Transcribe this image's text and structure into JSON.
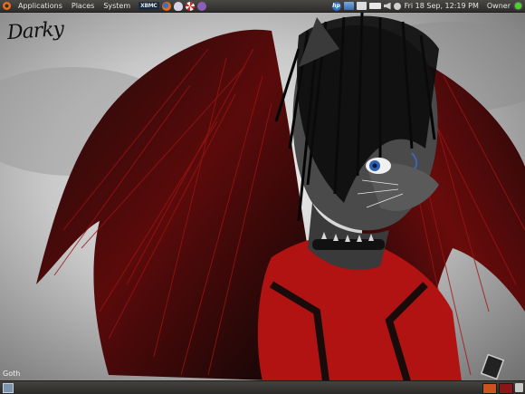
{
  "top_panel": {
    "menus": [
      "Applications",
      "Places",
      "System"
    ],
    "launchers": [
      {
        "name": "xbmc",
        "label": "XBMC"
      },
      {
        "name": "firefox-icon"
      },
      {
        "name": "pidgin-icon"
      },
      {
        "name": "help-lifebuoy-icon"
      },
      {
        "name": "game-icon"
      }
    ],
    "tray": {
      "icons": [
        "hp-icon",
        "network-icon",
        "mail-icon",
        "battery-icon",
        "volume-icon",
        "clock-icon"
      ],
      "hp_label": "hp",
      "clock": "Fri 18 Sep, 12:19 PM",
      "user": "Owner",
      "status_color": "#4fce2f"
    }
  },
  "wallpaper": {
    "signature": "Darky",
    "caption": "Goth"
  },
  "bottom_panel": {
    "icons": [
      "show-desktop-icon",
      "workspace-1",
      "workspace-2",
      "trash-icon"
    ],
    "workspace_colors": [
      "#c9541f",
      "#8a1717"
    ]
  }
}
